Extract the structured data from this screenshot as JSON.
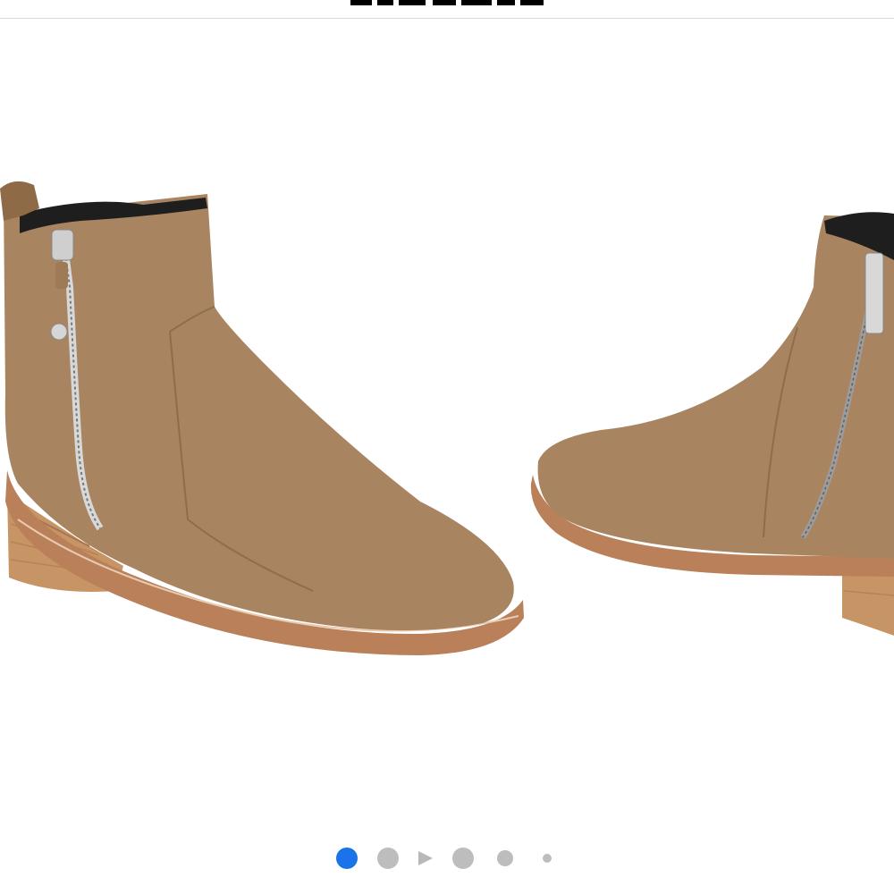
{
  "header": {
    "logo_icon": "brand-logo",
    "logo_color": "#000000"
  },
  "product_gallery": {
    "slides": [
      {
        "name": "boot-side-view",
        "icon": "ankle-boot-side-zip"
      },
      {
        "name": "boot-inner-view",
        "icon": "ankle-boot-inner-zip"
      }
    ],
    "boot_color": "#a98460",
    "sole_color": "#c9976a"
  },
  "pagination": {
    "active_index": 0,
    "total_dots": 5,
    "active_color": "#1a73e8",
    "inactive_color": "#bdbdbd",
    "has_video_indicator": true
  }
}
